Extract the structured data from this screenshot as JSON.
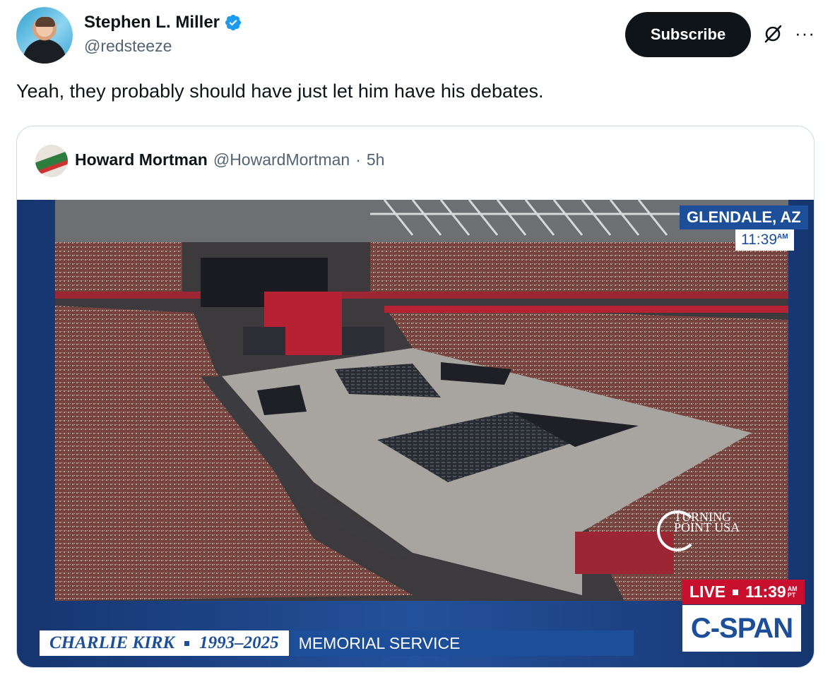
{
  "post": {
    "author_name": "Stephen L. Miller",
    "author_handle": "@redsteeze",
    "subscribe_label": "Subscribe",
    "more_label": "···",
    "text": "Yeah, they probably should have just let him have his debates."
  },
  "quoted_post": {
    "author_name": "Howard Mortman",
    "author_handle": "@HowardMortman",
    "separator": "·",
    "time": "5h"
  },
  "broadcast": {
    "location": "GLENDALE, AZ",
    "local_time": "11:39",
    "local_time_suffix": "AM",
    "live_label": "LIVE",
    "live_time": "11:39",
    "live_time_suffix_top": "AM",
    "live_time_suffix_bottom": "PT",
    "network": "C-SPAN",
    "lower_third_name": "CHARLIE KIRK",
    "lower_third_years": "1993–2025",
    "lower_third_event": "MEMORIAL SERVICE",
    "logo_line1": "TURNING",
    "logo_line2": "POINT USA"
  },
  "colors": {
    "verified_blue": "#1d9bf0",
    "cspan_blue": "#1d4e99",
    "live_red": "#c8102e"
  },
  "icons": [
    "verified-badge-icon",
    "grok-icon",
    "more-icon"
  ]
}
